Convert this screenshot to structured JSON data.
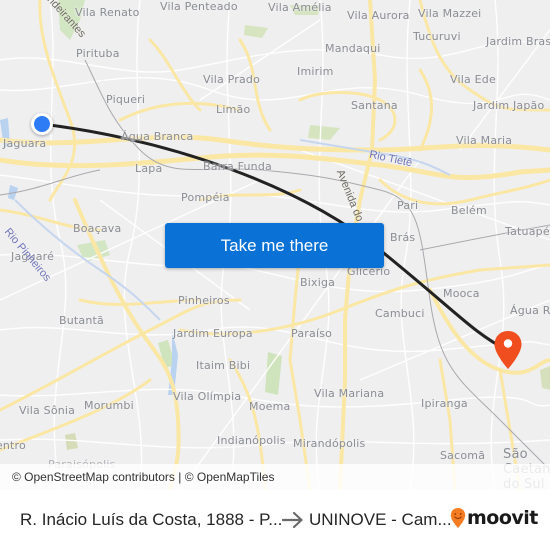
{
  "map": {
    "places": [
      {
        "name": "Vila Renato",
        "size": "normal"
      },
      {
        "name": "Vila Penteado",
        "size": "normal"
      },
      {
        "name": "Vila Amélia",
        "size": "normal"
      },
      {
        "name": "Vila Aurora",
        "size": "normal"
      },
      {
        "name": "Vila Mazzei",
        "size": "normal"
      },
      {
        "name": "Tucuruvi",
        "size": "normal"
      },
      {
        "name": "Jardim Brasil",
        "size": "normal"
      },
      {
        "name": "Pirituba",
        "size": "normal"
      },
      {
        "name": "Mandaqui",
        "size": "normal"
      },
      {
        "name": "Imirim",
        "size": "normal"
      },
      {
        "name": "Vila Ede",
        "size": "normal"
      },
      {
        "name": "Vila Prado",
        "size": "normal"
      },
      {
        "name": "Piqueri",
        "size": "normal"
      },
      {
        "name": "Limão",
        "size": "normal"
      },
      {
        "name": "Santana",
        "size": "normal"
      },
      {
        "name": "Jardim Japão",
        "size": "normal"
      },
      {
        "name": "Jaguara",
        "size": "normal"
      },
      {
        "name": "Água Branca",
        "size": "normal"
      },
      {
        "name": "Vila Maria",
        "size": "normal"
      },
      {
        "name": "Lapa",
        "size": "normal"
      },
      {
        "name": "Barra Funda",
        "size": "normal"
      },
      {
        "name": "Pompéia",
        "size": "normal"
      },
      {
        "name": "Pari",
        "size": "normal"
      },
      {
        "name": "Belém",
        "size": "normal"
      },
      {
        "name": "Boaçava",
        "size": "normal"
      },
      {
        "name": "Tatuapé",
        "size": "normal"
      },
      {
        "name": "Brás",
        "size": "normal"
      },
      {
        "name": "Jaguaré",
        "size": "normal"
      },
      {
        "name": "Glicério",
        "size": "normal"
      },
      {
        "name": "Bixiga",
        "size": "normal"
      },
      {
        "name": "Mooca",
        "size": "normal"
      },
      {
        "name": "Pinheiros",
        "size": "normal"
      },
      {
        "name": "Água Rasa",
        "size": "normal"
      },
      {
        "name": "Butantã",
        "size": "normal"
      },
      {
        "name": "Cambuci",
        "size": "normal"
      },
      {
        "name": "Jardim Europa",
        "size": "normal"
      },
      {
        "name": "Paraíso",
        "size": "normal"
      },
      {
        "name": "Itaim Bibi",
        "size": "normal"
      },
      {
        "name": "Vila Olímpia",
        "size": "normal"
      },
      {
        "name": "Vila Mariana",
        "size": "normal"
      },
      {
        "name": "Morumbi",
        "size": "normal"
      },
      {
        "name": "Moema",
        "size": "normal"
      },
      {
        "name": "Ipiranga",
        "size": "normal"
      },
      {
        "name": "Vila Sônia",
        "size": "normal"
      },
      {
        "name": "Indianópolis",
        "size": "normal"
      },
      {
        "name": "Mirandópolis",
        "size": "normal"
      },
      {
        "name": "Sacomã",
        "size": "normal"
      },
      {
        "name": "Centro",
        "size": "normal"
      },
      {
        "name": "São Caetano do Sul",
        "size": "large"
      },
      {
        "name": "Paraisópolis",
        "size": "normal"
      }
    ],
    "rivers": [
      "Rio Tietê",
      "Rio Pinheiros"
    ],
    "roads": [
      "Rodovia dos Bandeirantes",
      "Avenida do Estado"
    ],
    "origin_marker_color": "#2d7cf6",
    "destination_marker_color": "#f04e1e",
    "route_color": "#222222"
  },
  "cta": {
    "label": "Take me there",
    "color": "#0a72d6"
  },
  "attribution": "© OpenStreetMap contributors | © OpenMapTiles",
  "footer": {
    "origin": "R. Inácio Luís da Costa, 1888 - P...",
    "destination": "UNINOVE - Cam...",
    "brand": "moovit",
    "brand_color": "#f57c20"
  }
}
